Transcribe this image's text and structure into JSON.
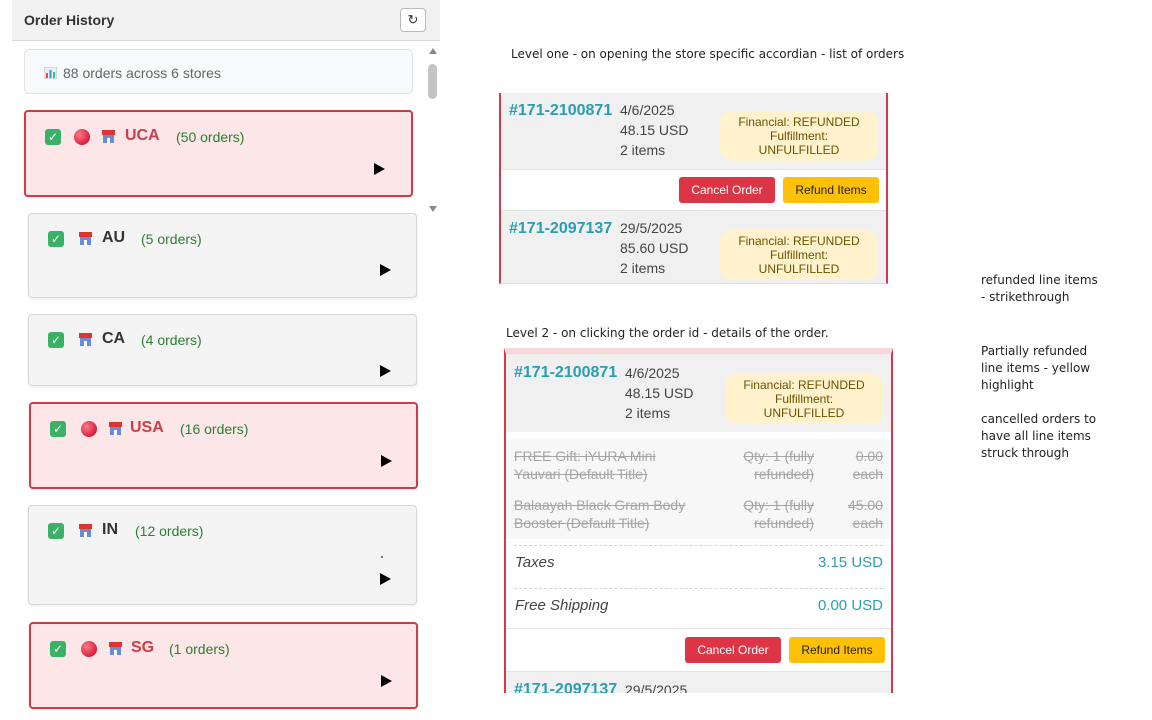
{
  "panel": {
    "title": "Order History",
    "refresh_label": "↻",
    "summary": "88 orders across 6 stores"
  },
  "stores": [
    {
      "code": "UCA",
      "count": "(50 orders)",
      "alert": true
    },
    {
      "code": "AU",
      "count": "(5 orders)",
      "alert": false
    },
    {
      "code": "CA",
      "count": "(4 orders)",
      "alert": false
    },
    {
      "code": "USA",
      "count": "(16 orders)",
      "alert": true
    },
    {
      "code": "IN",
      "count": "(12 orders)",
      "alert": false
    },
    {
      "code": "SG",
      "count": "(1 orders)",
      "alert": true
    }
  ],
  "notes": {
    "level1": "Level one - on opening the store specific accordian - list of orders",
    "level2": "Level 2 - on clicking the order id - details of the order.",
    "side1": "refunded line items - strikethrough",
    "side2": "Partially refunded line items - yellow highlight",
    "side3": "cancelled orders to have all line items struck through"
  },
  "level1": {
    "orders": [
      {
        "id": "#171-2100871",
        "date": "4/6/2025",
        "amount": "48.15 USD",
        "items": "2 items",
        "financial": "Financial: REFUNDED",
        "fulfillment": "Fulfillment: UNFULFILLED"
      },
      {
        "id": "#171-2097137",
        "date": "29/5/2025",
        "amount": "85.60 USD",
        "items": "2 items",
        "financial": "Financial: REFUNDED",
        "fulfillment": "Fulfillment: UNFULFILLED"
      }
    ],
    "cancel_label": "Cancel Order",
    "refund_label": "Refund Items"
  },
  "level2": {
    "order": {
      "id": "#171-2100871",
      "date": "4/6/2025",
      "amount": "48.15 USD",
      "items": "2 items",
      "financial": "Financial: REFUNDED",
      "fulfillment": "Fulfillment: UNFULFILLED"
    },
    "line_items": [
      {
        "name_1": "FREE Gift: iYURA Mini",
        "name_2": "Yauvari (Default Title)",
        "qty_1": "Qty: 1 (fully",
        "qty_2": "refunded)",
        "price_1": "0.00",
        "price_2": "each"
      },
      {
        "name_1": "Balaayah Black Gram Body",
        "name_2": "Booster (Default Title)",
        "qty_1": "Qty: 1 (fully",
        "qty_2": "refunded)",
        "price_1": "45.00",
        "price_2": "each"
      }
    ],
    "taxes_label": "Taxes",
    "taxes_value": "3.15 USD",
    "shipping_label": "Free Shipping",
    "shipping_value": "0.00 USD",
    "cancel_label": "Cancel Order",
    "refund_label": "Refund Items",
    "next_order": {
      "id": "#171-2097137",
      "date": "29/5/2025"
    }
  },
  "colors": {
    "alert_border": "#d13a4a",
    "alert_bg": "#fde6e7",
    "link": "#2a9db1",
    "badge_bg": "#fff2cc",
    "cancel": "#dc3545",
    "refund": "#ffc107",
    "count_text": "#2e7d32"
  }
}
